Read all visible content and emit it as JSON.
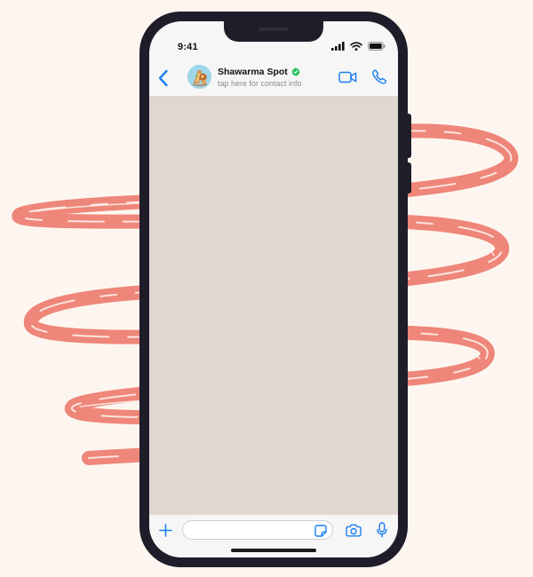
{
  "theme": {
    "page_background": "#fdf6f0",
    "scribble_color": "#ee8679",
    "phone_frame": "#1f1d29",
    "chat_background": "#e0d7d3",
    "accent": "#1a7ef0",
    "verified_badge": "#25c15a"
  },
  "status_bar": {
    "time": "9:41",
    "icons": [
      "cellular-signal-icon",
      "wifi-icon",
      "battery-icon"
    ]
  },
  "chat_header": {
    "contact_name": "Shawarma Spot",
    "subtitle": "tap here for contact info",
    "verified": true,
    "icons": [
      "back-chevron-icon",
      "avatar-food-icon",
      "verified-badge-icon",
      "video-camera-icon",
      "phone-icon"
    ]
  },
  "composer": {
    "value": "",
    "placeholder": "",
    "icons": [
      "plus-icon",
      "sticker-icon",
      "camera-icon",
      "microphone-icon"
    ]
  }
}
